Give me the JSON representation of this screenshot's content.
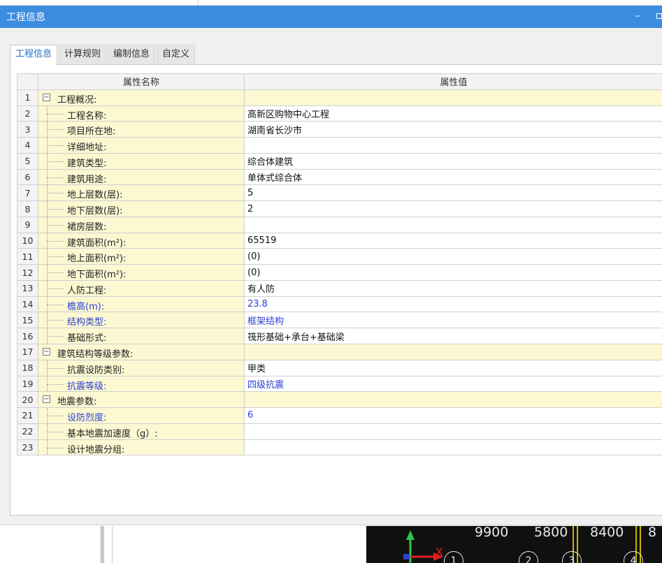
{
  "window": {
    "title": "工程信息",
    "minimize_glyph": "–"
  },
  "tabs": [
    {
      "label": "工程信息",
      "active": true
    },
    {
      "label": "计算规则",
      "active": false
    },
    {
      "label": "编制信息",
      "active": false
    },
    {
      "label": "自定义",
      "active": false
    }
  ],
  "table": {
    "headers": {
      "name": "属性名称",
      "value": "属性值"
    },
    "rows": [
      {
        "no": "1",
        "name": "工程概况:",
        "value": "",
        "group": true,
        "blue": false
      },
      {
        "no": "2",
        "name": "工程名称:",
        "value": "高新区购物中心工程",
        "group": false,
        "blue": false
      },
      {
        "no": "3",
        "name": "项目所在地:",
        "value": "湖南省长沙市",
        "group": false,
        "blue": false
      },
      {
        "no": "4",
        "name": "详细地址:",
        "value": "",
        "group": false,
        "blue": false
      },
      {
        "no": "5",
        "name": "建筑类型:",
        "value": "综合体建筑",
        "group": false,
        "blue": false
      },
      {
        "no": "6",
        "name": "建筑用途:",
        "value": "单体式综合体",
        "group": false,
        "blue": false
      },
      {
        "no": "7",
        "name": "地上层数(层):",
        "value": "5",
        "group": false,
        "blue": false
      },
      {
        "no": "8",
        "name": "地下层数(层):",
        "value": "2",
        "group": false,
        "blue": false
      },
      {
        "no": "9",
        "name": "裙房层数:",
        "value": "",
        "group": false,
        "blue": false
      },
      {
        "no": "10",
        "name": "建筑面积(m²):",
        "value": "65519",
        "group": false,
        "blue": false
      },
      {
        "no": "11",
        "name": "地上面积(m²):",
        "value": "(0)",
        "group": false,
        "blue": false
      },
      {
        "no": "12",
        "name": "地下面积(m²):",
        "value": "(0)",
        "group": false,
        "blue": false
      },
      {
        "no": "13",
        "name": "人防工程:",
        "value": "有人防",
        "group": false,
        "blue": false
      },
      {
        "no": "14",
        "name": "檐高(m):",
        "value": "23.8",
        "group": false,
        "blue": true
      },
      {
        "no": "15",
        "name": "结构类型:",
        "value": "框架结构",
        "group": false,
        "blue": true
      },
      {
        "no": "16",
        "name": "基础形式:",
        "value": "筏形基础+承台+基础梁",
        "group": false,
        "blue": false
      },
      {
        "no": "17",
        "name": "建筑结构等级参数:",
        "value": "",
        "group": true,
        "blue": false
      },
      {
        "no": "18",
        "name": "抗震设防类别:",
        "value": "甲类",
        "group": false,
        "blue": false
      },
      {
        "no": "19",
        "name": "抗震等级:",
        "value": "四级抗震",
        "group": false,
        "blue": true
      },
      {
        "no": "20",
        "name": "地震参数:",
        "value": "",
        "group": true,
        "blue": false
      },
      {
        "no": "21",
        "name": "设防烈度:",
        "value": "6",
        "group": false,
        "blue": true
      },
      {
        "no": "22",
        "name": "基本地震加速度（g）:",
        "value": "",
        "group": false,
        "blue": false
      },
      {
        "no": "23",
        "name": "设计地震分组:",
        "value": "",
        "group": false,
        "blue": false
      }
    ]
  },
  "background_cad": {
    "dimensions": [
      "9900",
      "5800",
      "8400",
      "8"
    ],
    "axis_labels": [
      "1",
      "2",
      "3",
      "4"
    ],
    "axis_x_label": "X"
  },
  "colors": {
    "titlebar": "#3c8ddf",
    "tab_active_text": "#1f6fc9",
    "property_name_bg": "#fbf8d2",
    "editable_blue": "#2a3fd4"
  }
}
